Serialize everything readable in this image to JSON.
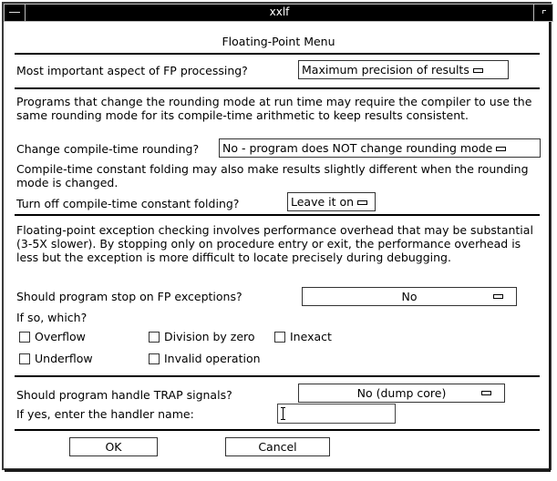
{
  "window": {
    "title": "xxlf"
  },
  "dialog": {
    "heading": "Floating-Point Menu",
    "fp_aspect": {
      "label": "Most important aspect of FP processing?",
      "selected": "Maximum precision of results"
    },
    "rounding": {
      "description": "Programs that change the rounding mode at run time may require the compiler to use the same rounding mode for its compile-time arithmetic to keep results consistent.",
      "label": "Change compile-time rounding?",
      "selected": "No - program does NOT change rounding mode",
      "folding_description": "Compile-time constant folding may also make results slightly different when the rounding mode is changed.",
      "folding_label": "Turn off compile-time constant folding?",
      "folding_selected": "Leave it on"
    },
    "exceptions": {
      "description": "Floating-point exception checking involves performance overhead that may be substantial (3-5X slower).  By stopping only on procedure entry or exit, the performance overhead is less but the exception is more difficult to locate precisely during debugging.",
      "stop_label": "Should program stop on FP exceptions?",
      "stop_selected": "No",
      "which_label": "If so, which?",
      "checkboxes": [
        {
          "label": "Overflow",
          "checked": false
        },
        {
          "label": "Division by zero",
          "checked": false
        },
        {
          "label": "Inexact",
          "checked": false
        },
        {
          "label": "Underflow",
          "checked": false
        },
        {
          "label": "Invalid operation",
          "checked": false
        }
      ]
    },
    "trap": {
      "label": "Should program handle TRAP signals?",
      "selected": "No (dump core)",
      "handler_label": "If yes, enter the handler name:",
      "handler_value": ""
    },
    "buttons": {
      "ok": "OK",
      "cancel": "Cancel"
    }
  }
}
